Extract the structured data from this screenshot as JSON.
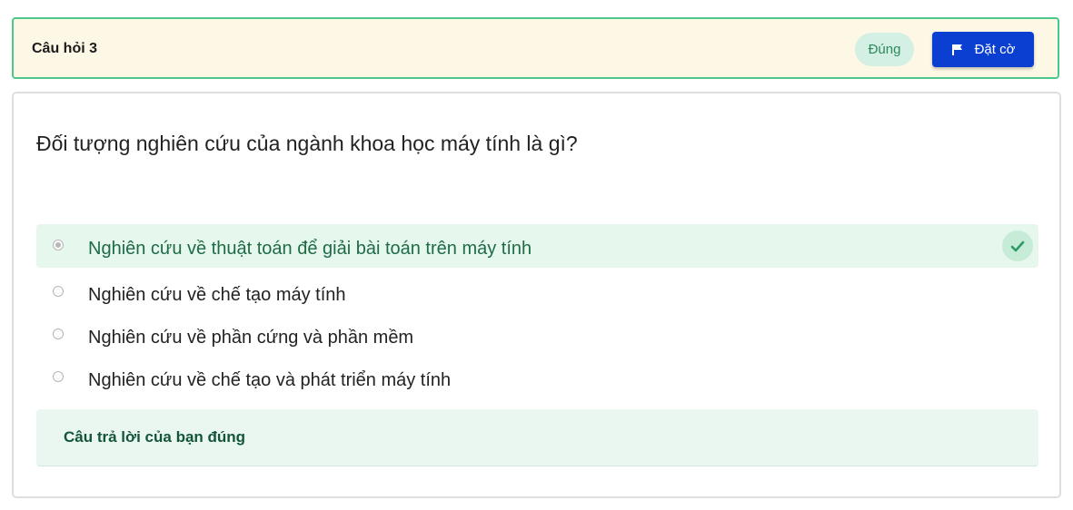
{
  "header": {
    "title": "Câu hỏi 3",
    "status": "Đúng",
    "flag_button_label": "Đặt cờ",
    "flag_icon": "flag-icon",
    "border_color": "#4cc98a",
    "background_color": "#fdf8e6",
    "accent_color": "#0b3fd1"
  },
  "question": {
    "text": "Đối tượng nghiên cứu của ngành khoa học máy tính là gì?",
    "options": [
      {
        "label": "Nghiên cứu về thuật toán để giải bài toán trên máy tính",
        "selected": true,
        "correct": true
      },
      {
        "label": "Nghiên cứu về chế tạo máy tính",
        "selected": false,
        "correct": false
      },
      {
        "label": "Nghiên cứu về phần cứng và phần mềm",
        "selected": false,
        "correct": false
      },
      {
        "label": "Nghiên cứu về chế tạo và phát triển máy tính",
        "selected": false,
        "correct": false
      }
    ],
    "correct_icon": "check-icon"
  },
  "feedback": {
    "text": "Câu trả lời của bạn đúng",
    "color": "#14553a"
  }
}
